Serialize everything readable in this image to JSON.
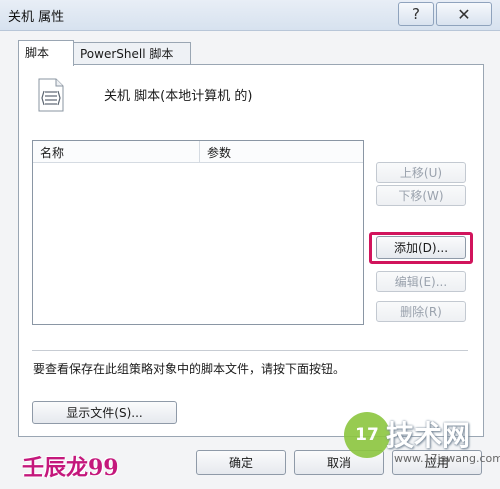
{
  "window": {
    "title": "关机 属性",
    "help_glyph": "?",
    "close_glyph": "✕"
  },
  "tabs": [
    {
      "label": "脚本",
      "active": true
    },
    {
      "label": "PowerShell 脚本",
      "active": false
    }
  ],
  "panel": {
    "icon": "script-file-icon",
    "heading": "关机 脚本(本地计算机 的)",
    "list": {
      "columns": [
        "名称",
        "参数"
      ],
      "rows": []
    },
    "buttons": {
      "move_up": "上移(U)",
      "move_down": "下移(W)",
      "add": "添加(D)...",
      "edit": "编辑(E)...",
      "remove": "删除(R)"
    },
    "info": "要查看保存在此组策略对象中的脚本文件，请按下面按钮。",
    "show_files": "显示文件(S)..."
  },
  "footer": {
    "ok": "确定",
    "cancel": "取消",
    "apply": "应用"
  },
  "highlight_color": "#d1145c",
  "watermarks": {
    "left": "壬辰龙99",
    "logo_number": "17",
    "brand": "技术网",
    "url": "www.17jswang.com"
  }
}
